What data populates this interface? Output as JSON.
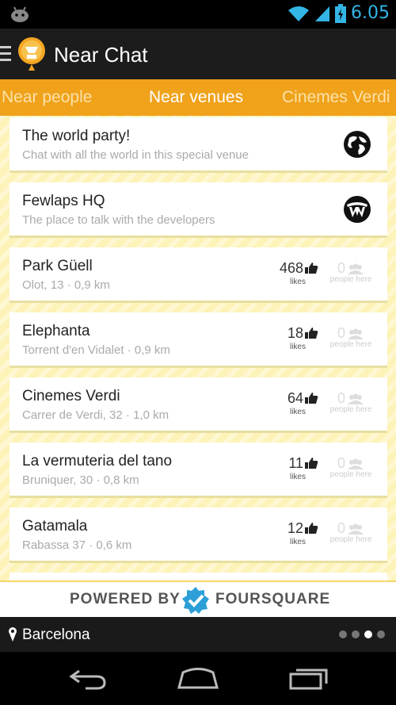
{
  "statusbar": {
    "time": "6.05",
    "icons": [
      "android-icon",
      "wifi-icon",
      "signal-icon",
      "battery-icon"
    ]
  },
  "actionbar": {
    "title": "Near Chat",
    "icons": [
      "menu-icon",
      "app-logo"
    ]
  },
  "tabs": [
    {
      "label": "Near people",
      "active": false
    },
    {
      "label": "Near venues",
      "active": true
    },
    {
      "label": "Cinemes Verdi",
      "active": false
    }
  ],
  "venues": [
    {
      "name": "The world party!",
      "subtitle": "Chat with all the world in this special venue",
      "badge": "globe-icon"
    },
    {
      "name": "Fewlaps HQ",
      "subtitle": "The place to talk with the developers",
      "badge": "fewlaps-logo"
    },
    {
      "name": "Park Güell",
      "address": "Olot, 13",
      "distance": "0,9 km",
      "likes": "468",
      "people": "0"
    },
    {
      "name": "Elephanta",
      "address": "Torrent d'en Vidalet",
      "distance": "0,9 km",
      "likes": "18",
      "people": "0"
    },
    {
      "name": "Cinemes Verdi",
      "address": "Carrer de Verdi, 32",
      "distance": "1,0 km",
      "likes": "64",
      "people": "0"
    },
    {
      "name": "La vermuteria del tano",
      "address": "Bruniquer, 30",
      "distance": "0,8 km",
      "likes": "11",
      "people": "0"
    },
    {
      "name": "Gatamala",
      "address": "Rabassa 37",
      "distance": "0,6 km",
      "likes": "12",
      "people": "0"
    }
  ],
  "labels": {
    "likes": "likes",
    "people_here": "people here",
    "separator": "·"
  },
  "powered": {
    "prefix": "POWERED BY",
    "brand": "FOURSQUARE"
  },
  "location": {
    "city": "Barcelona",
    "page_count": 4,
    "active_page": 3
  },
  "colors": {
    "accent": "#f0a21b",
    "list_bg": "#fdf3b8",
    "holo_blue": "#33b5e5",
    "foursquare_blue": "#2d9fd8"
  }
}
